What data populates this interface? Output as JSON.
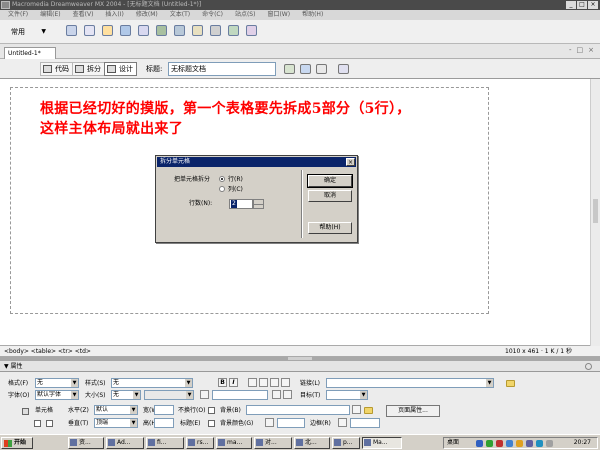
{
  "window": {
    "title": "Macromedia Dreamweaver MX 2004 - [无标题文档 (Untitled-1*)]",
    "controls": [
      "_",
      "□",
      "×"
    ]
  },
  "menubar": {
    "items": [
      "文件(F)",
      "编辑(E)",
      "查看(V)",
      "插入(I)",
      "修改(M)",
      "文本(T)",
      "命令(C)",
      "站点(S)",
      "窗口(W)",
      "帮助(H)"
    ]
  },
  "insertbar": {
    "category": "常用",
    "icons": [
      "hyperlink-icon",
      "email-link-icon",
      "named-anchor-icon",
      "table-icon",
      "layer-icon",
      "image-icon",
      "media-icon",
      "date-icon",
      "comment-icon",
      "template-icon",
      "tag-chooser-icon"
    ]
  },
  "document": {
    "tab_label": "Untitled-1*",
    "window_controls": [
      "-",
      "□",
      "×"
    ],
    "toolbar": {
      "code_label": "代码",
      "split_label": "拆分",
      "design_label": "设计",
      "title_label": "标题:",
      "title_value": "无标题文档"
    },
    "annotation_line1": "根据已经切好的摸版，第一个表格要先拆成5部分（5行），",
    "annotation_line2": "这样主体布局就出来了"
  },
  "dialog": {
    "title": "拆分单元格",
    "close": "×",
    "split_into_label": "把单元格拆分",
    "option_rows": "行(R)",
    "option_cols": "列(C)",
    "selected_option": "行(R)",
    "rows_count_label": "行数(N):",
    "rows_count_value": "2",
    "ok_label": "确定",
    "cancel_label": "取消",
    "help_label": "帮助(H)"
  },
  "statusbar": {
    "tag_path": "<body> <table> <tr> <td>",
    "dimensions": "1010 x 461 · 1 K / 1 秒"
  },
  "properties": {
    "header": "▼ 属性",
    "format_label": "格式(F)",
    "format_value": "无",
    "style_label": "样式(S)",
    "style_value": "无",
    "bold": "B",
    "italic": "I",
    "link_label": "链接(L)",
    "font_label": "字体(O)",
    "font_value": "默认字体",
    "size_label": "大小(S)",
    "size_value": "无",
    "target_label": "目标(T)",
    "cell_label": "单元格",
    "horz_label": "水平(Z)",
    "horz_value": "默认",
    "width_label": "宽(W)",
    "nowrap_label": "不换行(O)",
    "bg_label": "背景(B)",
    "page_props_label": "页面属性...",
    "vert_label": "垂直(T)",
    "vert_value": "顶端",
    "height_label": "高(H)",
    "header_label": "标题(E)",
    "bgcolor_label": "背景颜色(G)",
    "border_label": "边框(R)"
  },
  "taskbar": {
    "start": "开始",
    "tasks": [
      "资...",
      "Ad...",
      "fi...",
      "rs...",
      "ma...",
      "对...",
      "北...",
      "p...",
      "Ma..."
    ],
    "desktop_label": "桌面",
    "clock": "20:27"
  }
}
